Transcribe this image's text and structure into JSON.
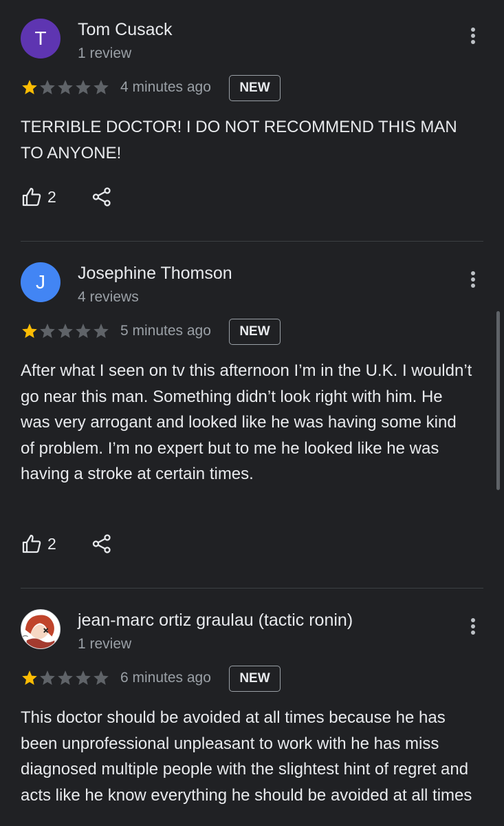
{
  "reviews": [
    {
      "avatar_letter": "T",
      "avatar_color": "#5e35b1",
      "name": "Tom Cusack",
      "review_count": "1 review",
      "rating": 1,
      "time": "4 minutes ago",
      "badge": "NEW",
      "text": "TERRIBLE DOCTOR! I DO NOT RECOMMEND THIS MAN TO ANYONE!",
      "likes": "2"
    },
    {
      "avatar_letter": "J",
      "avatar_color": "#4285f4",
      "name": "Josephine Thomson",
      "review_count": "4 reviews",
      "rating": 1,
      "time": "5 minutes ago",
      "badge": "NEW",
      "text": "After what I seen on tv this afternoon I’m in the U.K. I wouldn’t go near this man. Something didn’t look right with him. He was very arrogant and looked like he was having some kind of problem. I’m no expert but to me he looked like he was having a stroke at certain times.",
      "likes": "2"
    },
    {
      "avatar_letter": "",
      "avatar_color": "#ffffff",
      "name": "jean-marc ortiz graulau (tactic ronin)",
      "review_count": "1 review",
      "rating": 1,
      "time": "6 minutes ago",
      "badge": "NEW",
      "text": "This doctor should be avoided at all times because he has been unprofessional unpleasant to work with he has miss diagnosed multiple people with the slightest hint of regret and acts like he know everything he should be avoided at all times",
      "likes": ""
    }
  ],
  "colors": {
    "background": "#202124",
    "star_filled": "#fbbc04",
    "star_empty": "#5f6368"
  },
  "icons": {
    "more": "more-vert-icon",
    "like": "thumbs-up-icon",
    "share": "share-icon",
    "star": "star-icon"
  }
}
